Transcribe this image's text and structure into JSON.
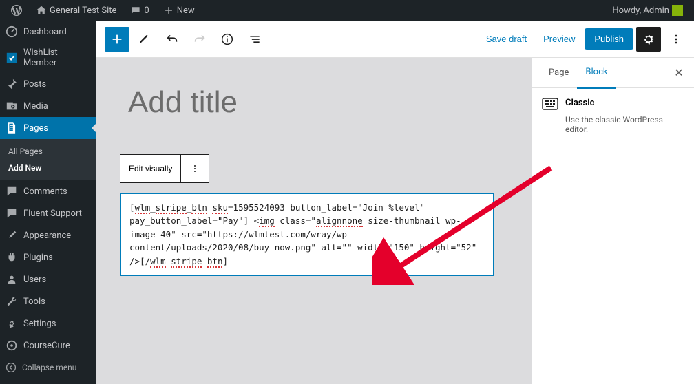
{
  "adminbar": {
    "site_name": "General Test Site",
    "comments_count": "0",
    "new_label": "New",
    "howdy": "Howdy, Admin"
  },
  "sidebar": {
    "items": [
      {
        "label": "Dashboard",
        "icon": "dashboard"
      },
      {
        "label": "WishList Member",
        "icon": "check"
      },
      {
        "label": "Posts",
        "icon": "pin"
      },
      {
        "label": "Media",
        "icon": "media"
      },
      {
        "label": "Pages",
        "icon": "pages",
        "active": true
      },
      {
        "label": "Comments",
        "icon": "comments"
      },
      {
        "label": "Fluent Support",
        "icon": "comments"
      },
      {
        "label": "Appearance",
        "icon": "brush"
      },
      {
        "label": "Plugins",
        "icon": "plug"
      },
      {
        "label": "Users",
        "icon": "user"
      },
      {
        "label": "Tools",
        "icon": "wrench"
      },
      {
        "label": "Settings",
        "icon": "settings"
      },
      {
        "label": "CourseCure",
        "icon": "course"
      }
    ],
    "sub": {
      "all": "All Pages",
      "add_new": "Add New"
    },
    "collapse": "Collapse menu"
  },
  "editor_header": {
    "save_draft": "Save draft",
    "preview": "Preview",
    "publish": "Publish"
  },
  "canvas": {
    "title_placeholder": "Add title",
    "edit_visually": "Edit visually",
    "code_content": "[wlm_stripe_btn sku=1595524093 button_label=\"Join %level\" pay_button_label=\"Pay\"] <img class=\"alignnone size-thumbnail wp-image-40\" src=\"https://wlmtest.com/wray/wp-content/uploads/2020/08/buy-now.png\" alt=\"\" width=\"150\" height=\"52\" />[/wlm_stripe_btn]"
  },
  "inspector": {
    "tab_page": "Page",
    "tab_block": "Block",
    "block_title": "Classic",
    "block_desc": "Use the classic WordPress editor."
  }
}
